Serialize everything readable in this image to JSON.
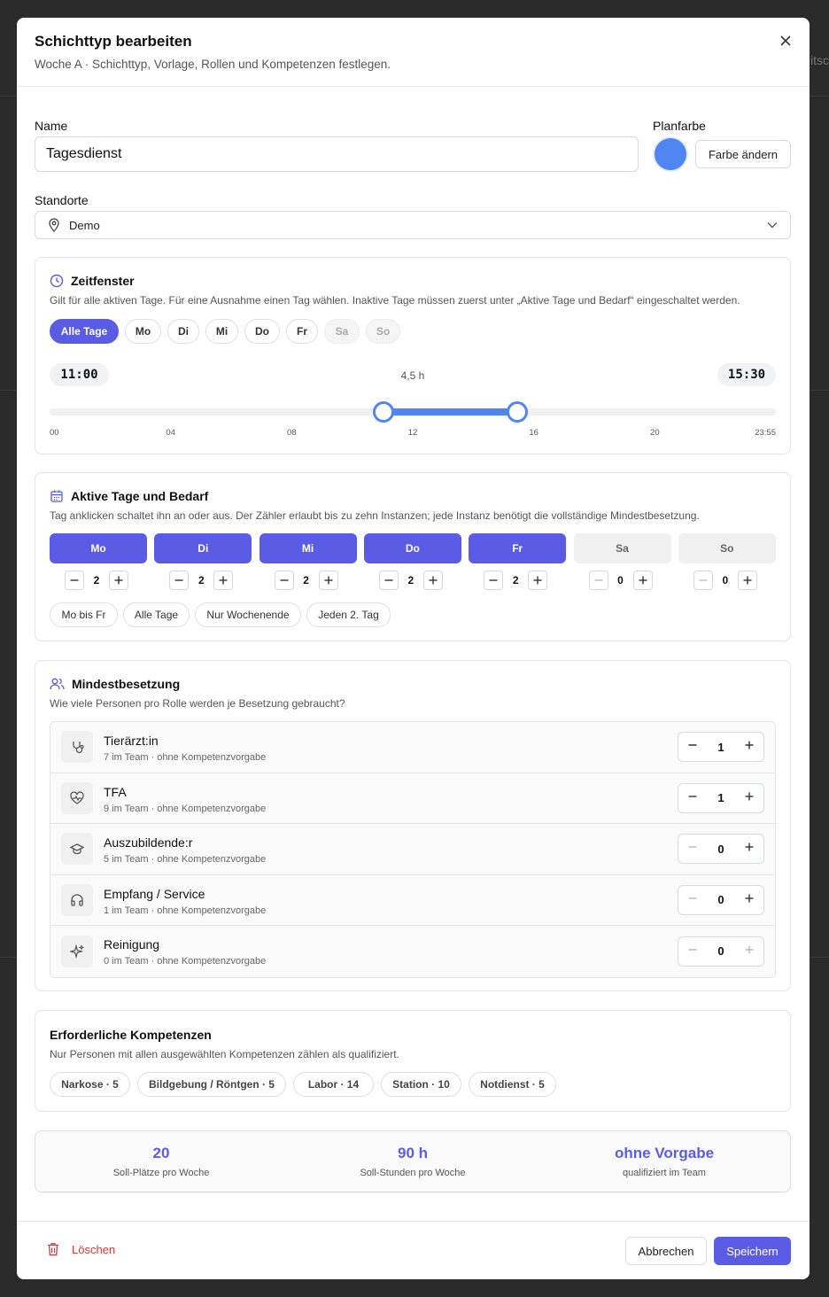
{
  "backdrop": {
    "partial_text": "itsc"
  },
  "dialog": {
    "title": "Schichttyp bearbeiten",
    "subtitle": "Woche A · Schichttyp, Vorlage, Rollen und Kompetenzen festlegen.",
    "close_icon": "close-icon"
  },
  "form": {
    "name_label": "Name",
    "name_value": "Tagesdienst",
    "color_label": "Planfarbe",
    "color_value": "#4f86f2",
    "change_color_label": "Farbe ändern",
    "locations_label": "Standorte",
    "location_value": "Demo"
  },
  "timewindow": {
    "title": "Zeitfenster",
    "description": "Gilt für alle aktiven Tage. Für eine Ausnahme einen Tag wählen. Inaktive Tage müssen zuerst unter „Aktive Tage und Bedarf“ eingeschaltet werden.",
    "day_filters": [
      {
        "label": "Alle Tage",
        "state": "active"
      },
      {
        "label": "Mo",
        "state": "normal"
      },
      {
        "label": "Di",
        "state": "normal"
      },
      {
        "label": "Mi",
        "state": "normal"
      },
      {
        "label": "Do",
        "state": "normal"
      },
      {
        "label": "Fr",
        "state": "normal"
      },
      {
        "label": "Sa",
        "state": "disabled"
      },
      {
        "label": "So",
        "state": "disabled"
      }
    ],
    "start": "11:00",
    "end": "15:30",
    "duration": "4,5 h",
    "range_start_fraction": 0.46,
    "range_end_fraction": 0.644,
    "ticks": [
      "00",
      "04",
      "08",
      "12",
      "16",
      "20",
      "23:55"
    ]
  },
  "active_days": {
    "title": "Aktive Tage und Bedarf",
    "description": "Tag anklicken schaltet ihn an oder aus. Der Zähler erlaubt bis zu zehn Instanzen; jede Instanz benötigt die vollständige Mindestbesetzung.",
    "days": [
      {
        "label": "Mo",
        "active": true,
        "count": "2"
      },
      {
        "label": "Di",
        "active": true,
        "count": "2"
      },
      {
        "label": "Mi",
        "active": true,
        "count": "2"
      },
      {
        "label": "Do",
        "active": true,
        "count": "2"
      },
      {
        "label": "Fr",
        "active": true,
        "count": "2"
      },
      {
        "label": "Sa",
        "active": false,
        "count": "0"
      },
      {
        "label": "So",
        "active": false,
        "count": "0"
      }
    ],
    "quick": [
      "Mo bis Fr",
      "Alle Tage",
      "Nur Wochenende",
      "Jeden 2. Tag"
    ]
  },
  "staffing": {
    "title": "Mindestbesetzung",
    "description": "Wie viele Personen pro Rolle werden je Besetzung gebraucht?",
    "roles": [
      {
        "name": "Tierärzt:in",
        "sub": "7 im Team · ohne Kompetenzvorgabe",
        "value": "1",
        "icon": "stethoscope-icon"
      },
      {
        "name": "TFA",
        "sub": "9 im Team · ohne Kompetenzvorgabe",
        "value": "1",
        "icon": "heart-pulse-icon"
      },
      {
        "name": "Auszubildende:r",
        "sub": "5 im Team · ohne Kompetenzvorgabe",
        "value": "0",
        "icon": "graduation-cap-icon"
      },
      {
        "name": "Empfang / Service",
        "sub": "1 im Team · ohne Kompetenzvorgabe",
        "value": "0",
        "icon": "headset-icon"
      },
      {
        "name": "Reinigung",
        "sub": "0 im Team · ohne Kompetenzvorgabe",
        "value": "0",
        "icon": "sparkles-icon"
      }
    ]
  },
  "competencies": {
    "title": "Erforderliche Kompetenzen",
    "description": "Nur Personen mit allen ausgewählten Kompetenzen zählen als qualifiziert.",
    "items": [
      "Narkose · 5",
      "Bildgebung / Röntgen · 5",
      "Labor · 14",
      "Station · 10",
      "Notdienst · 5"
    ]
  },
  "summary": [
    {
      "value": "20",
      "label": "Soll-Plätze pro Woche"
    },
    {
      "value": "90 h",
      "label": "Soll-Stunden pro Woche"
    },
    {
      "value": "ohne Vorgabe",
      "label": "qualifiziert im Team"
    }
  ],
  "footer": {
    "delete_label": "Löschen",
    "cancel_label": "Abbrechen",
    "save_label": "Speichern"
  },
  "colors": {
    "accent": "#5b5ce6",
    "danger": "#d63b3b",
    "plan_color": "#4f86f2"
  }
}
